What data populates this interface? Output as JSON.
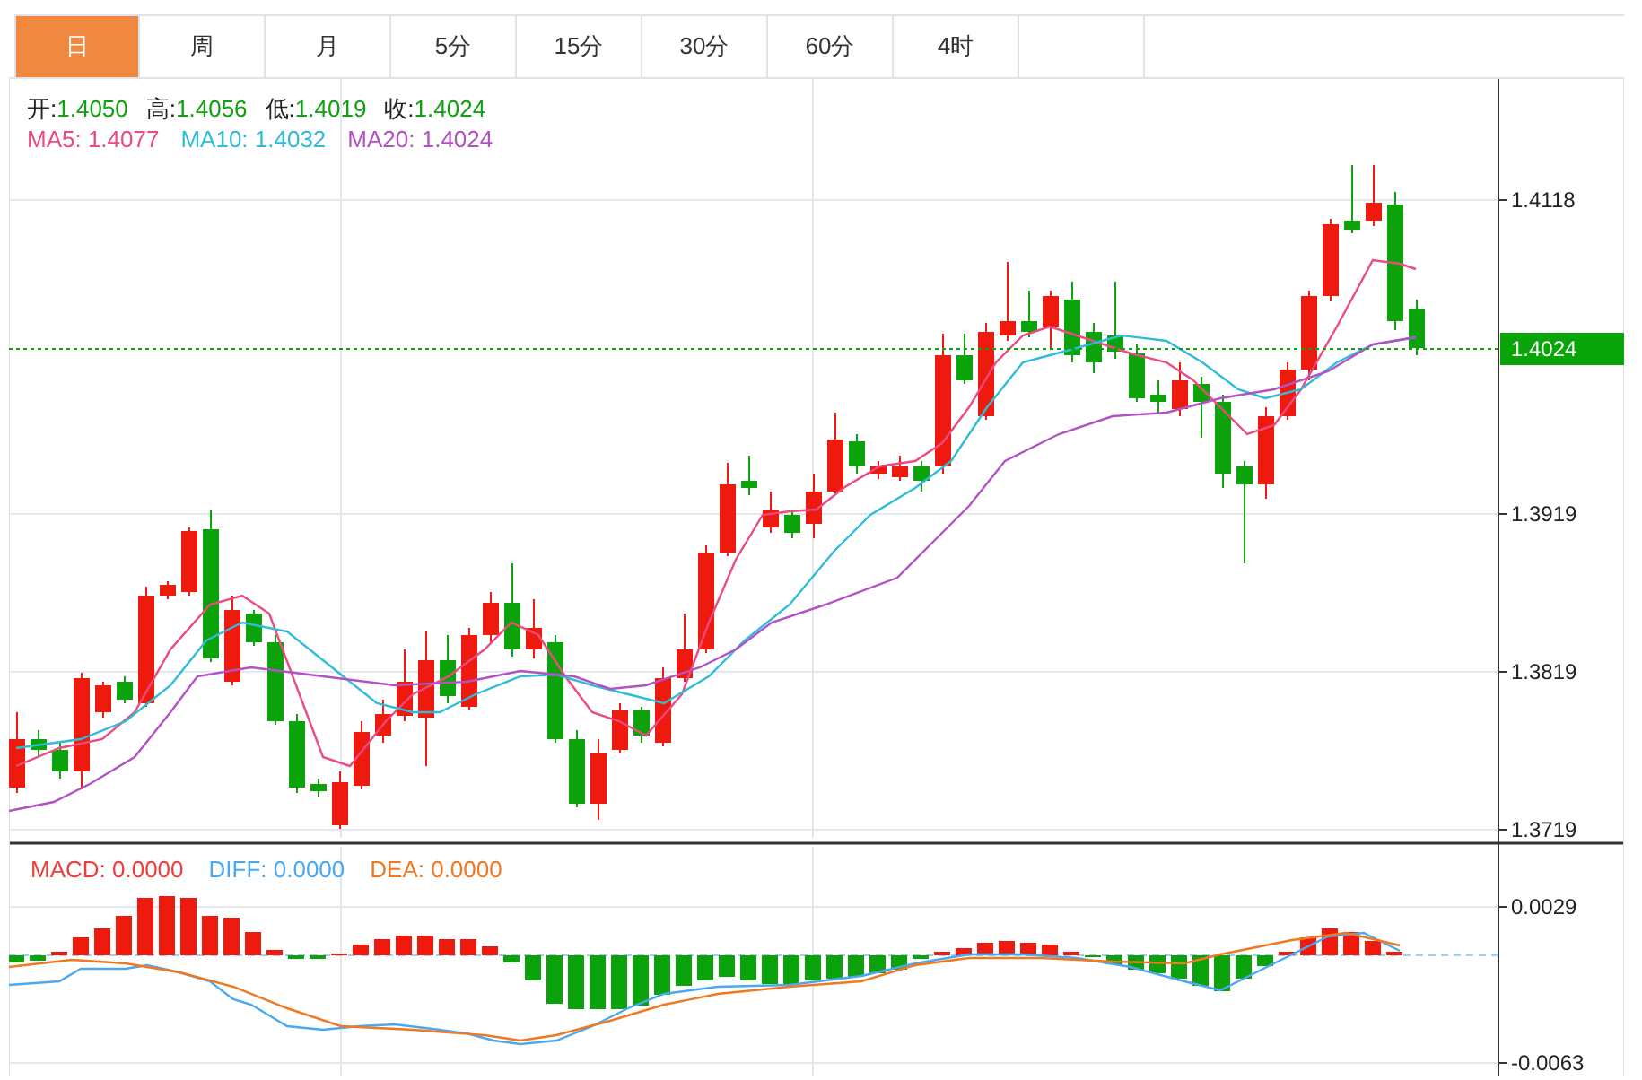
{
  "tabs": [
    {
      "label": "日",
      "selected": true
    },
    {
      "label": "周",
      "selected": false
    },
    {
      "label": "月",
      "selected": false
    },
    {
      "label": "5分",
      "selected": false
    },
    {
      "label": "15分",
      "selected": false
    },
    {
      "label": "30分",
      "selected": false
    },
    {
      "label": "60分",
      "selected": false
    },
    {
      "label": "4时",
      "selected": false
    }
  ],
  "price_panel": {
    "ohlc": [
      {
        "label": "开:",
        "value": "1.4050"
      },
      {
        "label": "高:",
        "value": "1.4056"
      },
      {
        "label": "低:",
        "value": "1.4019"
      },
      {
        "label": "收:",
        "value": "1.4024"
      }
    ],
    "ma": [
      {
        "label": "MA5:",
        "value": "1.4077",
        "color": "#ec4a80"
      },
      {
        "label": "MA10:",
        "value": "1.4032",
        "color": "#2fbcd8"
      },
      {
        "label": "MA20:",
        "value": "1.4024",
        "color": "#b451c4"
      }
    ],
    "axis_ticks": [
      "1.4118",
      "1.3919",
      "1.3819",
      "1.3719"
    ],
    "current_price": "1.4024"
  },
  "macd_panel": {
    "legend": [
      {
        "label": "MACD:",
        "value": "0.0000",
        "color": "#f03c3c"
      },
      {
        "label": "DIFF:",
        "value": "0.0000",
        "color": "#4aa8f0"
      },
      {
        "label": "DEA:",
        "value": "0.0000",
        "color": "#f07820"
      }
    ],
    "axis_ticks": [
      "0.0029",
      "-0.0063"
    ]
  }
}
